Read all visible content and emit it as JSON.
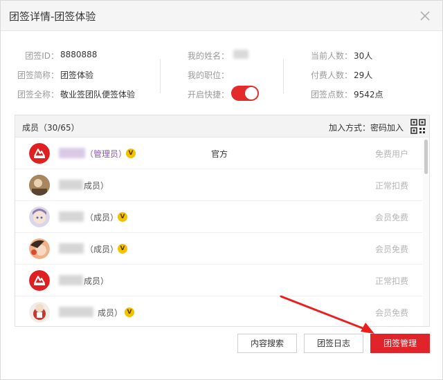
{
  "dialog": {
    "title": "团签详情-团签体验"
  },
  "info": {
    "col1": [
      {
        "label": "团签ID：",
        "value": "8880888"
      },
      {
        "label": "团签简称：",
        "value": "团签体验"
      },
      {
        "label": "团签全称：",
        "value": "敬业签团队便签体验"
      }
    ],
    "col2": [
      {
        "label": "我的姓名：",
        "value": ""
      },
      {
        "label": "我的职位：",
        "value": ""
      },
      {
        "label": "开启快捷：",
        "value": ""
      }
    ],
    "col3": [
      {
        "label": "当前人数：",
        "value": "30人"
      },
      {
        "label": "付费人数：",
        "value": "29人"
      },
      {
        "label": "团签点数：",
        "value": "9542点"
      }
    ],
    "shortcut_enabled": true
  },
  "members": {
    "header": "成员（30/65）",
    "join_method": "加入方式：密码加入",
    "rows": [
      {
        "role": "（管理员）",
        "mid": "官方",
        "status": "免费用户"
      },
      {
        "role": "成员）",
        "mid": "",
        "status": "正常扣费"
      },
      {
        "role": "（成员）",
        "mid": "",
        "status": "会员免费"
      },
      {
        "role": "（成员）",
        "mid": "",
        "status": "会员免费"
      },
      {
        "role": "成员）",
        "mid": "",
        "status": "正常扣费"
      },
      {
        "role": "成员）",
        "mid": "",
        "status": "会员免费"
      }
    ]
  },
  "buttons": {
    "search": "内容搜索",
    "log": "团签日志",
    "manage": "团签管理"
  },
  "colors": {
    "accent": "#e0242a",
    "admin_role": "#8a5bb0",
    "vip_badge": "#f2c200"
  }
}
